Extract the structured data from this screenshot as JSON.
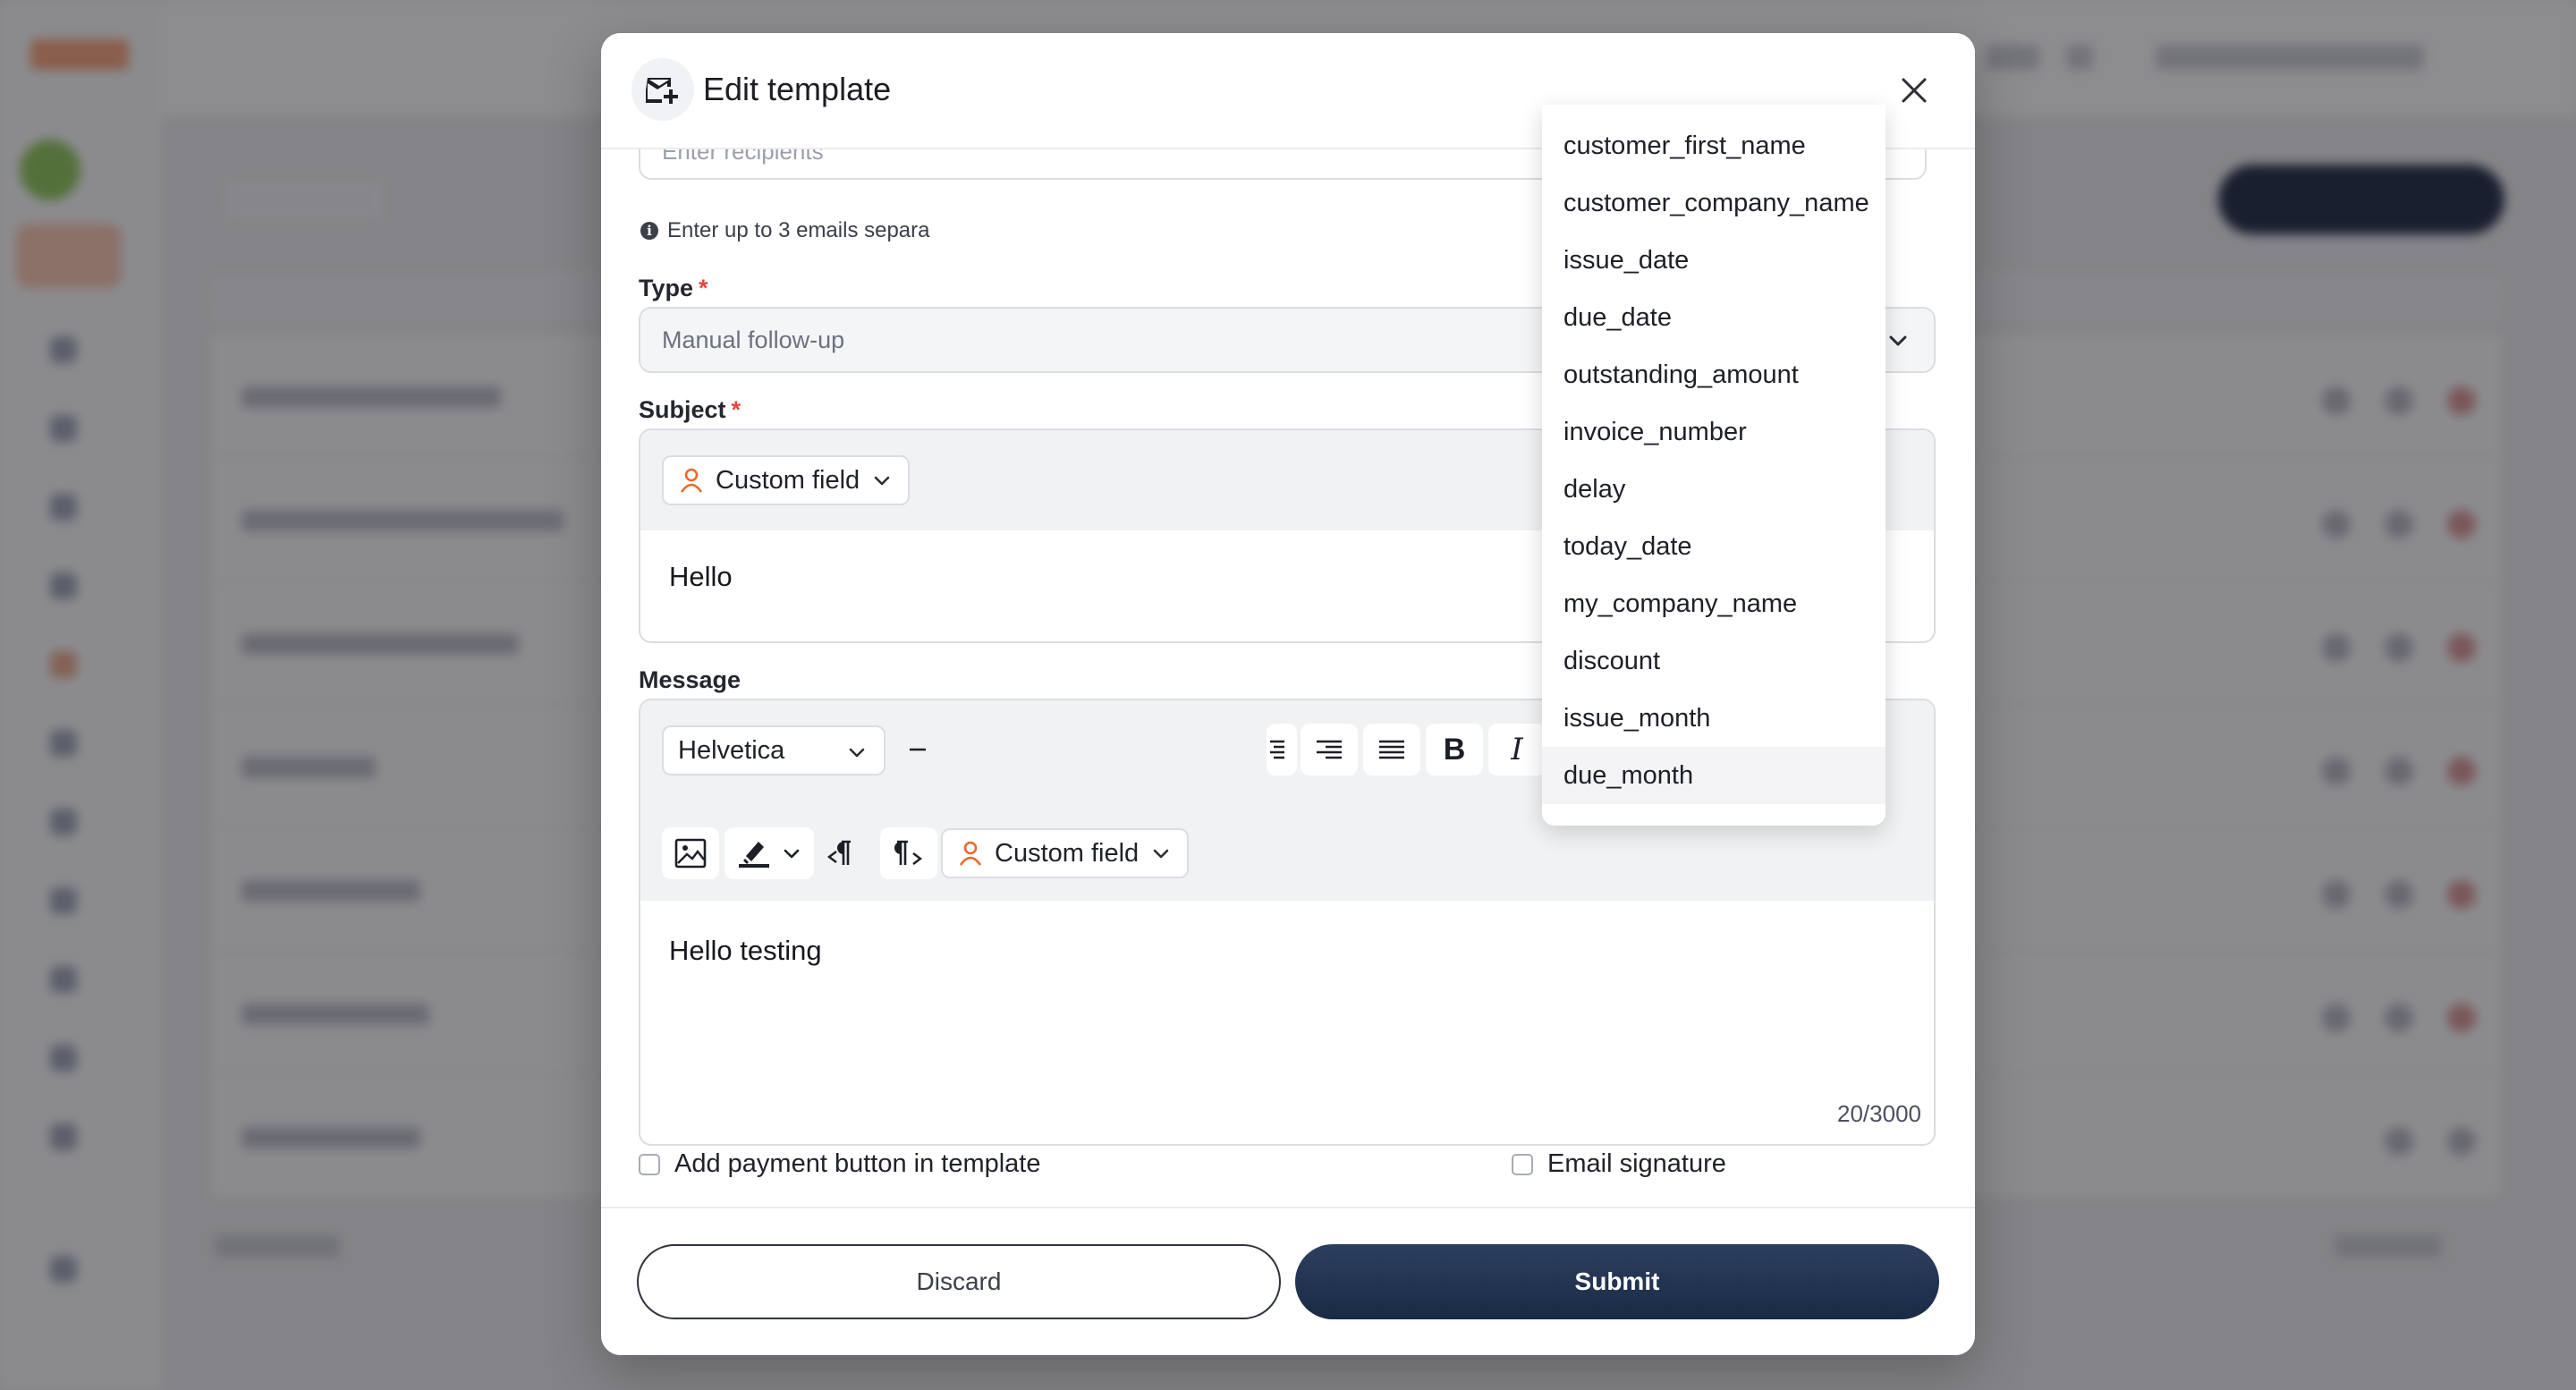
{
  "modal": {
    "title": "Edit template",
    "recipients_placeholder": "Enter recipients",
    "recipients_hint": "Enter up to 3 emails separa",
    "type": {
      "label": "Type",
      "required_mark": "*",
      "value": "Manual follow-up"
    },
    "subject": {
      "label": "Subject",
      "required_mark": "*",
      "custom_field_label": "Custom field",
      "content": "Hello"
    },
    "message": {
      "label": "Message",
      "font": "Helvetica",
      "custom_field_label": "Custom field",
      "content": "Hello testing",
      "char_count": "20/3000"
    },
    "options": {
      "payment_button_label": "Add payment button in template",
      "signature_label": "Email signature"
    },
    "footer": {
      "discard_label": "Discard",
      "submit_label": "Submit"
    }
  },
  "custom_field_menu": {
    "items": [
      "customer_first_name",
      "customer_company_name",
      "issue_date",
      "due_date",
      "outstanding_amount",
      "invoice_number",
      "delay",
      "today_date",
      "my_company_name",
      "discount",
      "issue_month",
      "due_month"
    ],
    "hovered": "due_month"
  },
  "icons": {
    "header": "mail-edit-icon",
    "close": "close-icon",
    "custom_field": "person-icon"
  },
  "colors": {
    "primary": "#1f2f4d",
    "required": "#e2463d",
    "custom_field_icon": "#e86a2c"
  }
}
